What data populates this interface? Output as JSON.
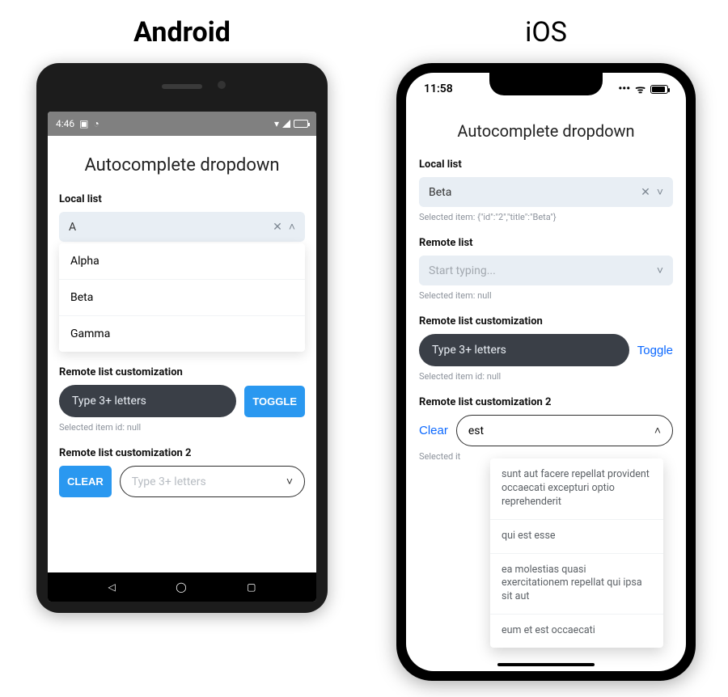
{
  "platforms": {
    "android": "Android",
    "ios": "iOS"
  },
  "android": {
    "status": {
      "time": "4:46"
    },
    "app_title": "Autocomplete dropdown",
    "local": {
      "label": "Local list",
      "value": "A",
      "options": [
        "Alpha",
        "Beta",
        "Gamma"
      ]
    },
    "remote_custom": {
      "label": "Remote list customization",
      "placeholder": "Type 3+ letters",
      "toggle": "TOGGLE",
      "helper": "Selected item id: null"
    },
    "remote_custom2": {
      "label": "Remote list customization 2",
      "clear": "CLEAR",
      "placeholder": "Type 3+ letters"
    }
  },
  "ios": {
    "status": {
      "time": "11:58"
    },
    "app_title": "Autocomplete dropdown",
    "local": {
      "label": "Local list",
      "value": "Beta",
      "helper": "Selected item: {\"id\":\"2\",\"title\":\"Beta\"}"
    },
    "remote": {
      "label": "Remote list",
      "placeholder": "Start typing...",
      "helper": "Selected item: null"
    },
    "remote_custom": {
      "label": "Remote list customization",
      "placeholder": "Type 3+ letters",
      "toggle": "Toggle",
      "helper": "Selected item id: null"
    },
    "remote_custom2": {
      "label": "Remote list customization 2",
      "clear": "Clear",
      "value": "est",
      "helper_prefix": "Selected it",
      "suggestions": [
        "sunt aut facere repellat provident occaecati excepturi optio reprehenderit",
        "qui est esse",
        "ea molestias quasi exercitationem repellat qui ipsa sit aut",
        "eum et est occaecati"
      ]
    }
  }
}
